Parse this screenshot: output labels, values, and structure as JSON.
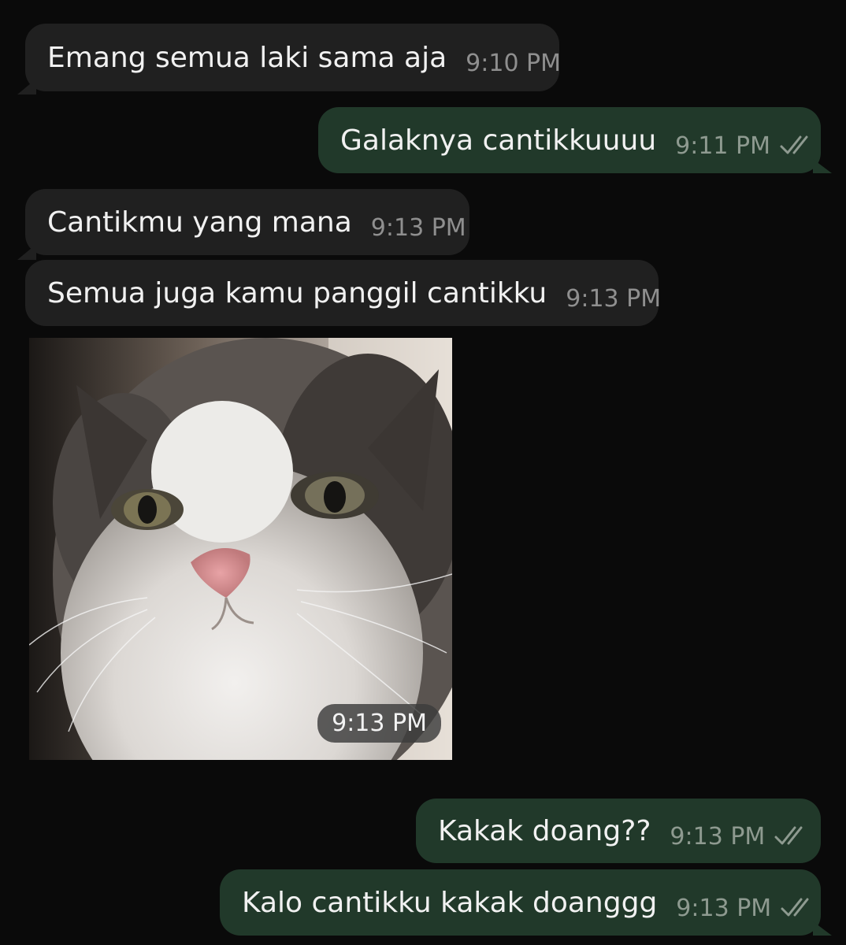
{
  "messages": [
    {
      "text": "Emang semua laki sama aja",
      "time": "9:10 PM"
    },
    {
      "text": "Galaknya cantikkuuuu",
      "time": "9:11 PM"
    },
    {
      "text": "Cantikmu yang mana",
      "time": "9:13 PM"
    },
    {
      "text": "Semua juga kamu panggil cantikku",
      "time": "9:13 PM"
    },
    {
      "image": "cat-photo",
      "time": "9:13 PM"
    },
    {
      "text": "Kakak doang??",
      "time": "9:13 PM"
    },
    {
      "text": "Kalo cantikku kakak doanggg",
      "time": "9:13 PM"
    }
  ],
  "colors": {
    "background": "#0a0a0a",
    "incoming_bubble": "#202020",
    "outgoing_bubble": "#21392a",
    "read_ticks": "#8e9a90"
  },
  "icons": {
    "read_receipt": "double-check-icon"
  }
}
